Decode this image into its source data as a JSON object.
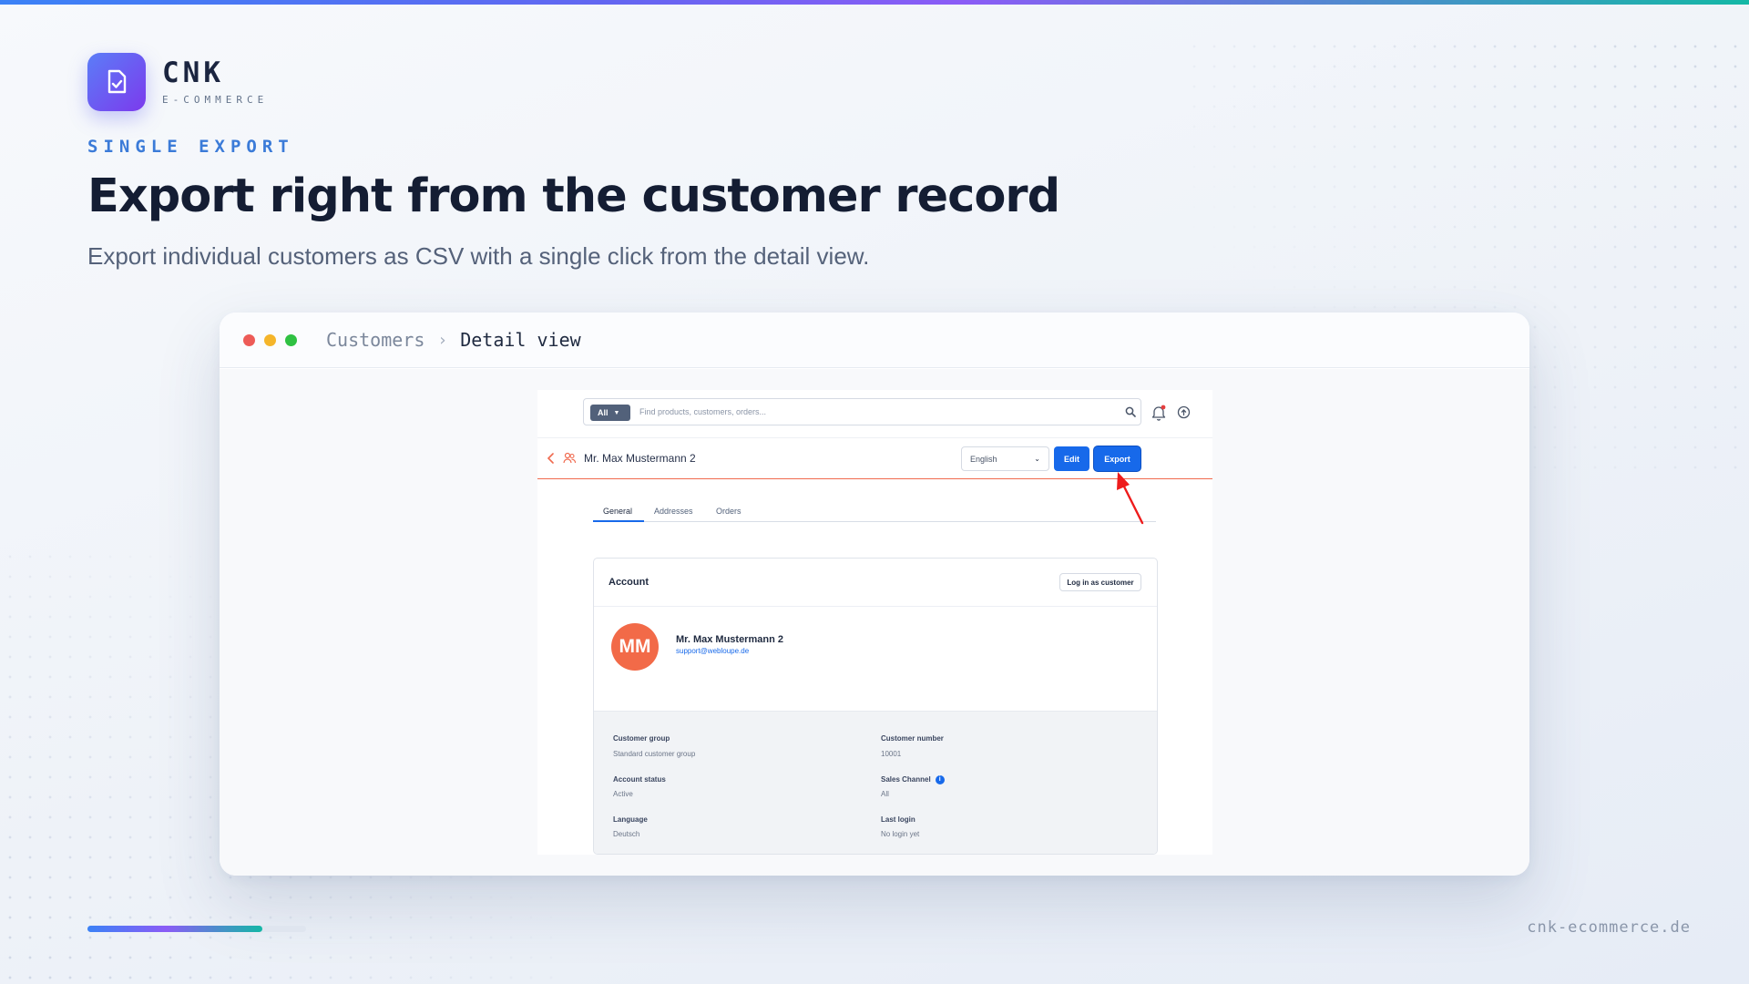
{
  "brand": {
    "name": "CNK",
    "tagline": "E-COMMERCE"
  },
  "hero": {
    "eyebrow": "SINGLE EXPORT",
    "title": "Export right from the customer record",
    "subtitle": "Export individual customers as CSV with a single click from the detail view."
  },
  "window": {
    "breadcrumb": {
      "parent": "Customers",
      "separator": "›",
      "current": "Detail view"
    },
    "dot_colors": [
      "#ed5b57",
      "#f5b52a",
      "#2fc142"
    ]
  },
  "app": {
    "search": {
      "scope": "All",
      "placeholder": "Find products, customers, orders..."
    },
    "customer_title": "Mr. Max Mustermann 2",
    "language": "English",
    "edit_label": "Edit",
    "export_label": "Export",
    "tabs": [
      "General",
      "Addresses",
      "Orders"
    ],
    "active_tab": "General",
    "account": {
      "title": "Account",
      "login_label": "Log in as customer",
      "initials": "MM",
      "name": "Mr. Max Mustermann 2",
      "email": "support@webloupe.de"
    },
    "fields": [
      {
        "label": "Customer group",
        "value": "Standard customer group"
      },
      {
        "label": "Customer number",
        "value": "10001"
      },
      {
        "label": "Account status",
        "value": "Active"
      },
      {
        "label": "Sales Channel",
        "value": "All"
      },
      {
        "label": "Language",
        "value": "Deutsch"
      },
      {
        "label": "Last login",
        "value": "No login yet"
      }
    ],
    "accent_color": "#1769ea",
    "avatar_color": "#f26a48"
  },
  "progress": 0.8,
  "footer": {
    "url": "cnk-ecommerce.de"
  }
}
